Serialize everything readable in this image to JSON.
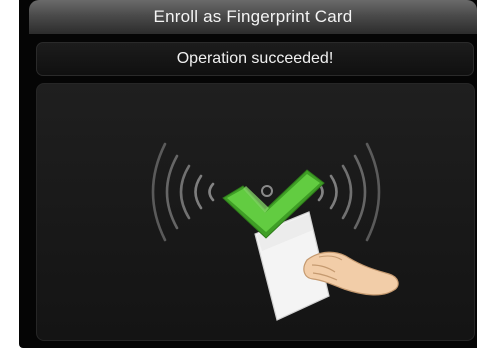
{
  "title": "Enroll as Fingerprint Card",
  "status_message": "Operation succeeded!",
  "colors": {
    "background": "#050505",
    "title_bar": "#4b4b4b",
    "check_green": "#4cbb2f",
    "wave_lines": "#9a9a9a"
  },
  "icons": {
    "illustration": "card-tap-success-illustration"
  }
}
